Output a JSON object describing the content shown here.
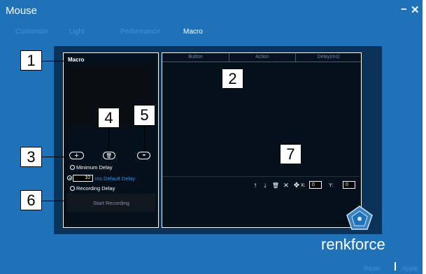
{
  "window": {
    "title": "Mouse",
    "minimize": "−",
    "close": "✕"
  },
  "tabs": [
    {
      "label": "Customize"
    },
    {
      "label": "Light"
    },
    {
      "label": "Performance"
    },
    {
      "label": "Macro",
      "active": true
    }
  ],
  "macro_panel": {
    "title": "Macro",
    "add_icon": "+",
    "delete_icon": "🗑",
    "more_icon": "•••",
    "options": {
      "minimum_delay": "Minimum Delay",
      "default_delay_value": "10",
      "default_delay_label": "ms Default Delay",
      "recording_delay": "Recording Delay",
      "selected": "default"
    },
    "start_recording": "Start Recording"
  },
  "action_table": {
    "columns": [
      "Button",
      "Action",
      "Delay(ms)"
    ],
    "toolbar": {
      "up": "↑",
      "down": "↓",
      "delete": "🗑",
      "clear": "⨯",
      "move": "✥",
      "x_label": "X:",
      "x_value": "0",
      "y_label": "Y:",
      "y_value": "0"
    }
  },
  "brand": "renkforce",
  "footer": {
    "reset": "Reset",
    "apply": "Apply"
  },
  "callouts": [
    "1",
    "2",
    "3",
    "4",
    "5",
    "6",
    "7"
  ],
  "colors": {
    "window_bg": "#1f72b8",
    "panel_bg": "#0b3259",
    "accent": "#3f93d8"
  }
}
